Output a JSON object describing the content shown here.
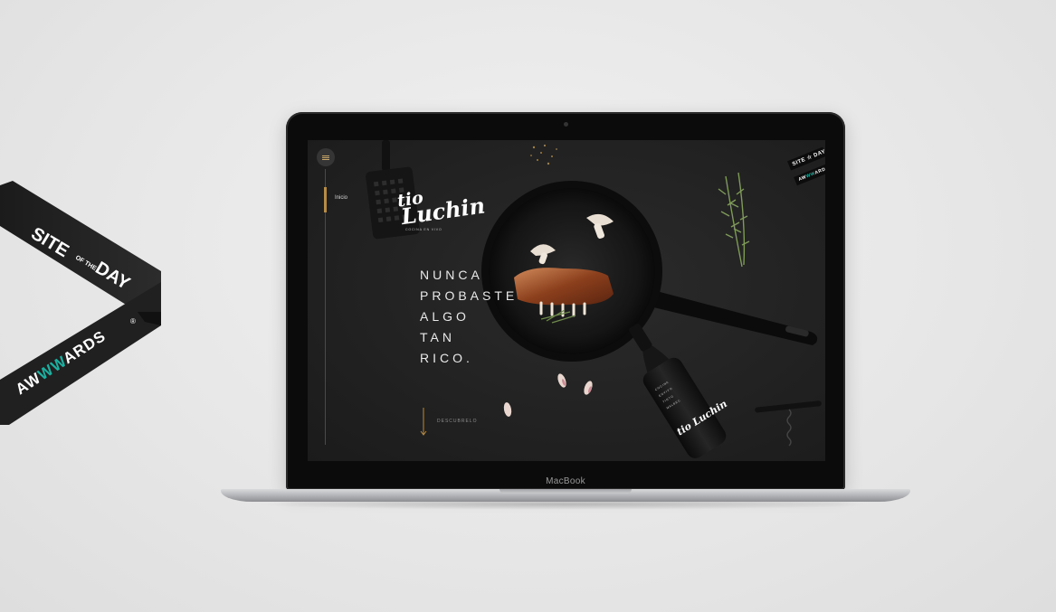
{
  "awwwards_ribbon": {
    "site": "SITE",
    "of_the": "OF THE",
    "day": "DAY",
    "brand": "AWWWARDS",
    "registered": "®",
    "accent_color": "#1bb0a0"
  },
  "laptop": {
    "model_label": "MacBook"
  },
  "site": {
    "nav": {
      "active_item": "Inicio"
    },
    "logo": {
      "line1": "tio",
      "line2": "Luchin",
      "tagline": "COCINA EN VIVO"
    },
    "headline": [
      "NUNCA",
      "PROBASTE",
      "ALGO",
      "TAN",
      "RICO."
    ],
    "scroll_label": "DESCUBRELO",
    "badge": {
      "line1": "SITE ☆ DAY",
      "line2_a": "AW",
      "line2_b": "WW",
      "line2_c": "ARDS"
    },
    "bottle_label": "tio Luchin",
    "accent_color": "#b38b4a"
  }
}
